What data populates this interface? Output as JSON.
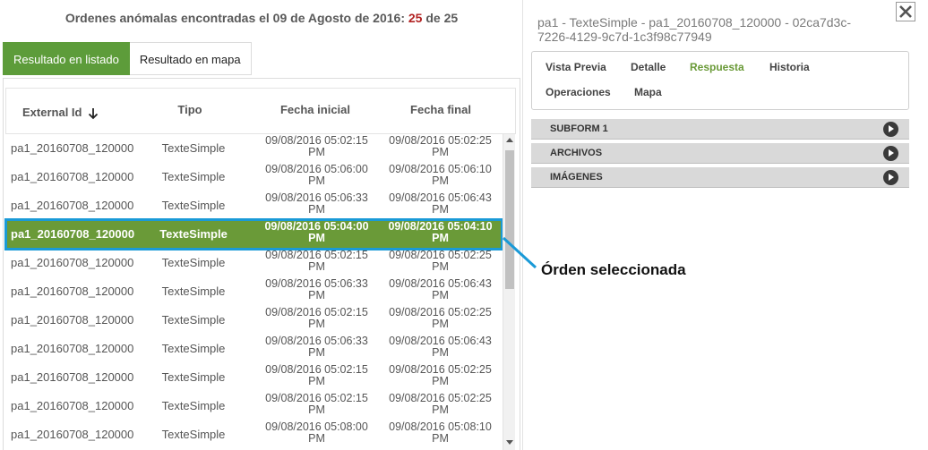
{
  "heading": {
    "prefix": "Ordenes anómalas encontradas el 09 de Agosto de 2016:",
    "count": "25",
    "of": "de",
    "total": "25"
  },
  "view_tabs": {
    "list_label": "Resultado en listado",
    "map_label": "Resultado en mapa"
  },
  "table": {
    "columns": [
      "External Id",
      "Tipo",
      "Fecha inicial",
      "Fecha final"
    ],
    "rows": [
      {
        "id": "pa1_20160708_120000",
        "tipo": "TexteSimple",
        "ini1": "09/08/2016 05:02:15",
        "ini2": "PM",
        "fin1": "09/08/2016 05:02:25",
        "fin2": "PM"
      },
      {
        "id": "pa1_20160708_120000",
        "tipo": "TexteSimple",
        "ini1": "09/08/2016 05:06:00",
        "ini2": "PM",
        "fin1": "09/08/2016 05:06:10",
        "fin2": "PM"
      },
      {
        "id": "pa1_20160708_120000",
        "tipo": "TexteSimple",
        "ini1": "09/08/2016 05:06:33",
        "ini2": "PM",
        "fin1": "09/08/2016 05:06:43",
        "fin2": "PM"
      },
      {
        "id": "pa1_20160708_120000",
        "tipo": "TexteSimple",
        "ini1": "09/08/2016 05:04:00",
        "ini2": "PM",
        "fin1": "09/08/2016 05:04:10",
        "fin2": "PM"
      },
      {
        "id": "pa1_20160708_120000",
        "tipo": "TexteSimple",
        "ini1": "09/08/2016 05:02:15",
        "ini2": "PM",
        "fin1": "09/08/2016 05:02:25",
        "fin2": "PM"
      },
      {
        "id": "pa1_20160708_120000",
        "tipo": "TexteSimple",
        "ini1": "09/08/2016 05:06:33",
        "ini2": "PM",
        "fin1": "09/08/2016 05:06:43",
        "fin2": "PM"
      },
      {
        "id": "pa1_20160708_120000",
        "tipo": "TexteSimple",
        "ini1": "09/08/2016 05:02:15",
        "ini2": "PM",
        "fin1": "09/08/2016 05:02:25",
        "fin2": "PM"
      },
      {
        "id": "pa1_20160708_120000",
        "tipo": "TexteSimple",
        "ini1": "09/08/2016 05:06:33",
        "ini2": "PM",
        "fin1": "09/08/2016 05:06:43",
        "fin2": "PM"
      },
      {
        "id": "pa1_20160708_120000",
        "tipo": "TexteSimple",
        "ini1": "09/08/2016 05:02:15",
        "ini2": "PM",
        "fin1": "09/08/2016 05:02:25",
        "fin2": "PM"
      },
      {
        "id": "pa1_20160708_120000",
        "tipo": "TexteSimple",
        "ini1": "09/08/2016 05:02:15",
        "ini2": "PM",
        "fin1": "09/08/2016 05:02:25",
        "fin2": "PM"
      },
      {
        "id": "pa1_20160708_120000",
        "tipo": "TexteSimple",
        "ini1": "09/08/2016 05:08:00",
        "ini2": "PM",
        "fin1": "09/08/2016 05:08:10",
        "fin2": "PM"
      }
    ],
    "selected_index": 3,
    "sort_icon": "arrow-down-icon"
  },
  "callout": {
    "label": "Órden seleccionada",
    "color": "#1a9ad7"
  },
  "detail": {
    "title_line1": "pa1 - TexteSimple - pa1_20160708_120000 - 02ca7d3c-",
    "title_line2": "7226-4129-9c7d-1c3f98c77949",
    "tabs": [
      "Vista Previa",
      "Detalle",
      "Respuesta",
      "Historia",
      "Operaciones",
      "Mapa"
    ],
    "active_tab": "Respuesta",
    "sections": [
      "SUBFORM 1",
      "ARCHIVOS",
      "IMÁGENES"
    ],
    "close_icon": "close-icon",
    "section_icon": "play-icon"
  },
  "colors": {
    "accent_green": "#5d9c3a",
    "selected_row": "#6a9a38",
    "highlight_blue": "#1a9ad7",
    "count_red": "#b22222"
  }
}
